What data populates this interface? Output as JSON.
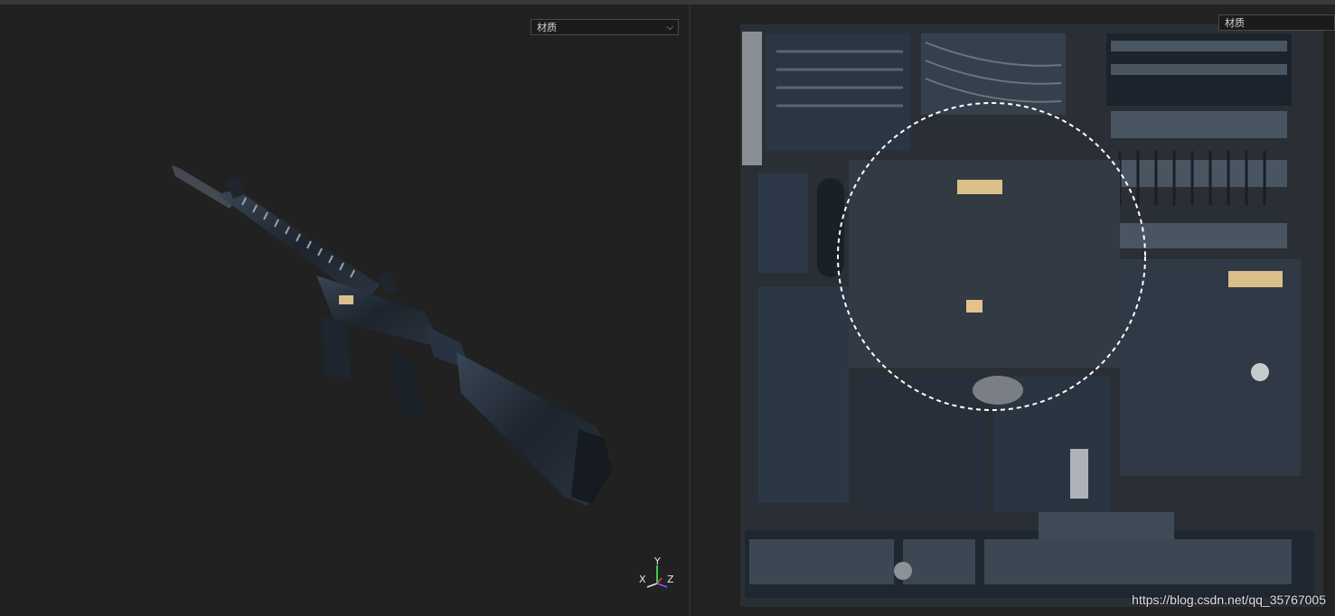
{
  "left_panel": {
    "material_dropdown": {
      "selected": "材质"
    }
  },
  "right_panel": {
    "material_dropdown": {
      "selected": "材质"
    }
  },
  "axis_gizmo": {
    "x": "X",
    "y": "Y",
    "z": "Z"
  },
  "watermark": "https://blog.csdn.net/qq_35767005",
  "colors": {
    "background": "#212121",
    "metal_dark": "#1f2630",
    "metal_blue": "#2d3a4a",
    "accent_tan": "#d9c08a"
  },
  "icons": {
    "dropdown": "chevron-down-icon",
    "axis": "axis-gizmo-icon"
  }
}
